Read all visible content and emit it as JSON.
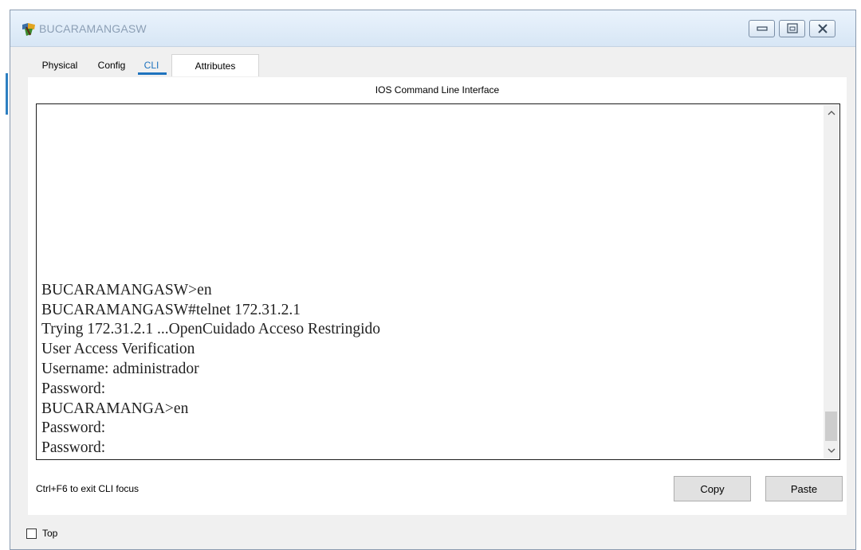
{
  "window": {
    "title": "BUCARAMANGASW",
    "controls": {
      "minimize": "minimize-icon",
      "maximize": "maximize-icon",
      "close": "close-icon"
    }
  },
  "tabs": [
    {
      "label": "Physical",
      "active": false
    },
    {
      "label": "Config",
      "active": false
    },
    {
      "label": "CLI",
      "active": true
    },
    {
      "label": "Attributes",
      "active": false
    }
  ],
  "panel": {
    "title": "IOS Command Line Interface"
  },
  "terminal": {
    "lines": [
      "BUCARAMANGASW>en",
      "BUCARAMANGASW#telnet 172.31.2.1",
      "Trying 172.31.2.1 ...OpenCuidado Acceso Restringido",
      "",
      "",
      "User Access Verification",
      "",
      "Username: administrador",
      "Password:",
      "BUCARAMANGA>en",
      "Password:",
      "Password:"
    ]
  },
  "footer": {
    "hint": "Ctrl+F6 to exit CLI focus",
    "copy_label": "Copy",
    "paste_label": "Paste"
  },
  "bottom": {
    "top_label": "Top",
    "top_checked": false
  },
  "colors": {
    "accent": "#1e73be",
    "terminal_border": "#1c1c1c"
  }
}
